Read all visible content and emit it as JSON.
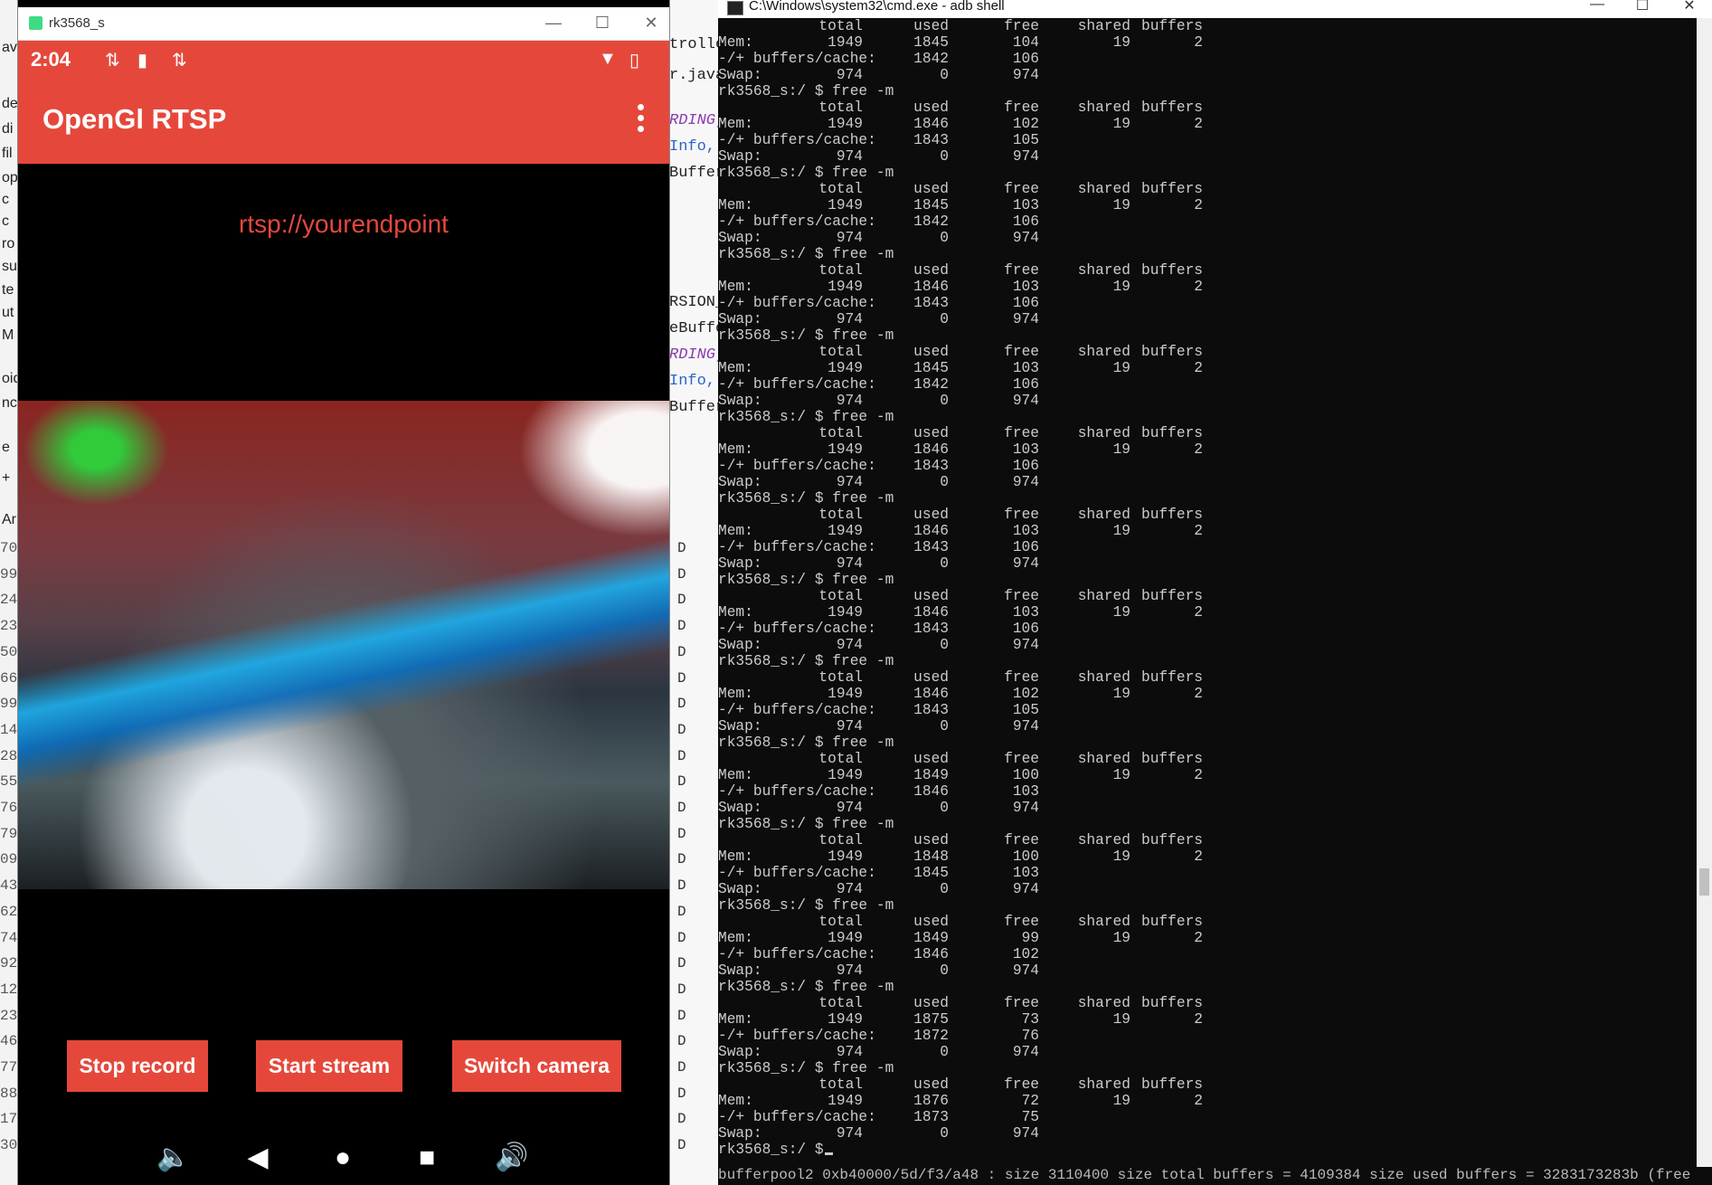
{
  "ide": {
    "left_labels": [
      "ava",
      "de",
      "di",
      "fil",
      "op",
      "c",
      "c",
      "ro",
      "su",
      "te",
      "ut",
      "M",
      "oid",
      "nc",
      "e",
      "+",
      "Ar"
    ],
    "line_numbers": [
      "70",
      "99",
      "24",
      "23",
      "50",
      "66",
      "99",
      "14",
      "28",
      "55",
      "76",
      "79",
      "09",
      "43",
      "62",
      "74",
      "92",
      "12",
      "23",
      "46",
      "77",
      "88",
      "17",
      "30"
    ],
    "mid_fragments": [
      {
        "text": "troller",
        "style": "plain"
      },
      {
        "text": "r.java",
        "style": "plain"
      },
      {
        "text": "RDING)",
        "style": "purple"
      },
      {
        "text": "Info,",
        "style": "blue"
      },
      {
        "text": "Buffer",
        "style": "plain"
      },
      {
        "text": "RSION_",
        "style": "plain"
      },
      {
        "text": "eBuffe",
        "style": "plain"
      },
      {
        "text": "RDING)",
        "style": "purple"
      },
      {
        "text": "Info,",
        "style": "blue"
      },
      {
        "text": "Buffer",
        "style": "plain"
      }
    ],
    "log_level": "D"
  },
  "emulator": {
    "window_title": "rk3568_s",
    "status": {
      "time": "2:04"
    },
    "app_title": "OpenGl RTSP",
    "rtsp_url": "rtsp://yourendpoint",
    "buttons": {
      "stop_record": "Stop record",
      "start_stream": "Start stream",
      "switch_camera": "Switch camera"
    }
  },
  "cmd": {
    "window_title": "C:\\Windows\\system32\\cmd.exe - adb shell",
    "prompt": "rk3568_s:/ $",
    "command": "free -m",
    "labels": {
      "mem": "Mem:",
      "buffers_cache": "-/+ buffers/cache:",
      "swap": "Swap:"
    },
    "headers": [
      "total",
      "used",
      "free",
      "shared",
      "buffers"
    ],
    "top_partial": {
      "mem": [
        "1949",
        "1845",
        "104",
        "19",
        "2"
      ],
      "bc": [
        "1842",
        "106"
      ],
      "swap": [
        "974",
        "0",
        "974"
      ]
    },
    "outputs": [
      {
        "mem": [
          "1949",
          "1846",
          "102",
          "19",
          "2"
        ],
        "bc": [
          "1843",
          "105"
        ],
        "swap": [
          "974",
          "0",
          "974"
        ]
      },
      {
        "mem": [
          "1949",
          "1845",
          "103",
          "19",
          "2"
        ],
        "bc": [
          "1842",
          "106"
        ],
        "swap": [
          "974",
          "0",
          "974"
        ]
      },
      {
        "mem": [
          "1949",
          "1846",
          "103",
          "19",
          "2"
        ],
        "bc": [
          "1843",
          "106"
        ],
        "swap": [
          "974",
          "0",
          "974"
        ]
      },
      {
        "mem": [
          "1949",
          "1845",
          "103",
          "19",
          "2"
        ],
        "bc": [
          "1842",
          "106"
        ],
        "swap": [
          "974",
          "0",
          "974"
        ]
      },
      {
        "mem": [
          "1949",
          "1846",
          "103",
          "19",
          "2"
        ],
        "bc": [
          "1843",
          "106"
        ],
        "swap": [
          "974",
          "0",
          "974"
        ]
      },
      {
        "mem": [
          "1949",
          "1846",
          "103",
          "19",
          "2"
        ],
        "bc": [
          "1843",
          "106"
        ],
        "swap": [
          "974",
          "0",
          "974"
        ]
      },
      {
        "mem": [
          "1949",
          "1846",
          "103",
          "19",
          "2"
        ],
        "bc": [
          "1843",
          "106"
        ],
        "swap": [
          "974",
          "0",
          "974"
        ]
      },
      {
        "mem": [
          "1949",
          "1846",
          "102",
          "19",
          "2"
        ],
        "bc": [
          "1843",
          "105"
        ],
        "swap": [
          "974",
          "0",
          "974"
        ]
      },
      {
        "mem": [
          "1949",
          "1849",
          "100",
          "19",
          "2"
        ],
        "bc": [
          "1846",
          "103"
        ],
        "swap": [
          "974",
          "0",
          "974"
        ]
      },
      {
        "mem": [
          "1949",
          "1848",
          "100",
          "19",
          "2"
        ],
        "bc": [
          "1845",
          "103"
        ],
        "swap": [
          "974",
          "0",
          "974"
        ]
      },
      {
        "mem": [
          "1949",
          "1849",
          "99",
          "19",
          "2"
        ],
        "bc": [
          "1846",
          "102"
        ],
        "swap": [
          "974",
          "0",
          "974"
        ]
      },
      {
        "mem": [
          "1949",
          "1875",
          "73",
          "19",
          "2"
        ],
        "bc": [
          "1872",
          "76"
        ],
        "swap": [
          "974",
          "0",
          "974"
        ]
      },
      {
        "mem": [
          "1949",
          "1876",
          "72",
          "19",
          "2"
        ],
        "bc": [
          "1873",
          "75"
        ],
        "swap": [
          "974",
          "0",
          "974"
        ]
      }
    ],
    "bottom_line": "bufferpool2 0xb40000/5d/f3/a48 : size 3110400 size total buffers = 4109384 size used buffers = 3283173283b (free"
  }
}
